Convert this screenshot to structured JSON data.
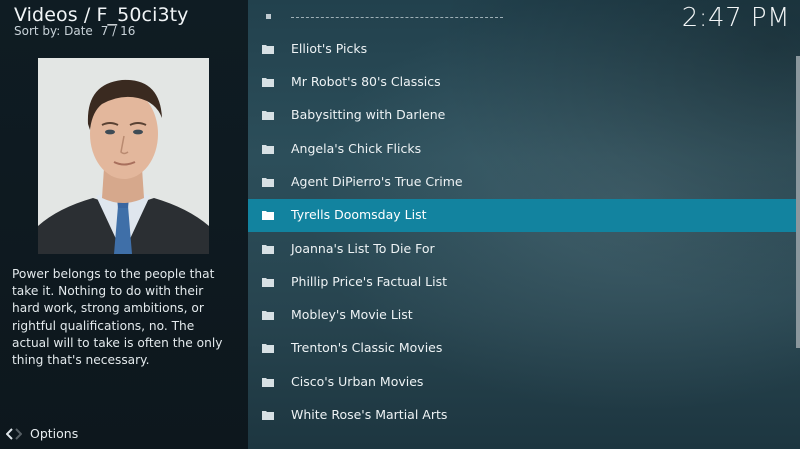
{
  "header": {
    "title": "Videos / F_50ci3ty",
    "sort_label": "Sort by: Date",
    "counter": "7 / 16"
  },
  "clock": "2:47 PM",
  "description": "Power belongs to the people that take it. Nothing to do with their hard work, strong ambitions, or rightful qualifications, no. The actual will to take is often the only thing that's necessary.",
  "options_label": "Options",
  "list": {
    "items": [
      {
        "label": "Elliot's Picks",
        "icon": "folder-icon"
      },
      {
        "label": "Mr Robot's 80's Classics",
        "icon": "folder-icon"
      },
      {
        "label": "Babysitting with Darlene",
        "icon": "folder-icon"
      },
      {
        "label": "Angela's Chick Flicks",
        "icon": "folder-icon"
      },
      {
        "label": "Agent DiPierro's True Crime",
        "icon": "folder-icon"
      },
      {
        "label": "Tyrells Doomsday List",
        "icon": "folder-icon",
        "selected": true
      },
      {
        "label": "Joanna's List To Die For",
        "icon": "folder-icon"
      },
      {
        "label": "Phillip Price's Factual List",
        "icon": "folder-icon"
      },
      {
        "label": "Mobley's Movie List",
        "icon": "folder-icon"
      },
      {
        "label": "Trenton's Classic Movies",
        "icon": "folder-icon"
      },
      {
        "label": "Cisco's Urban Movies",
        "icon": "folder-icon"
      },
      {
        "label": "White Rose's Martial Arts",
        "icon": "folder-icon"
      }
    ]
  },
  "colors": {
    "selected_row": "#12839f",
    "left_panel": "#0f1c23"
  }
}
